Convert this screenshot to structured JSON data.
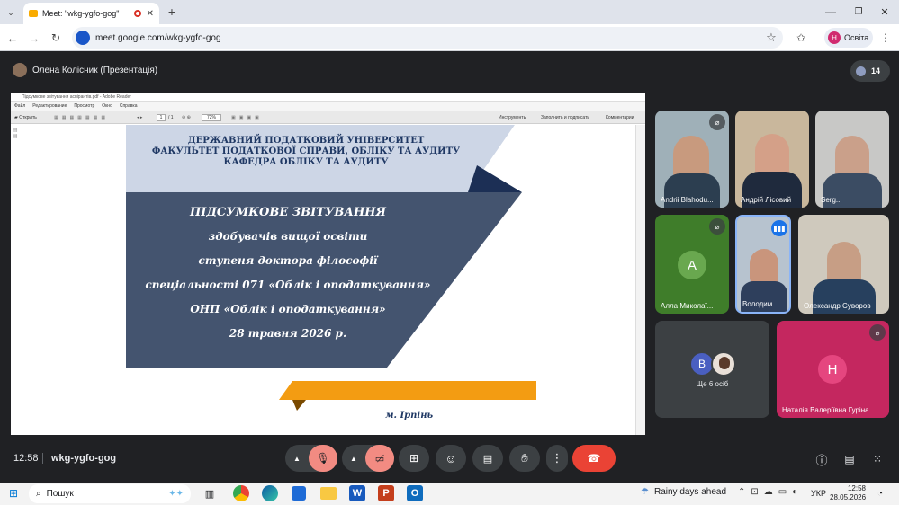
{
  "browser": {
    "tab_title": "Meet: \"wkg-ygfo-gog\"",
    "url": "meet.google.com/wkg-ygfo-gog",
    "profile_initial": "Н",
    "profile_label": "Освіта"
  },
  "meet": {
    "presenter": "Олена Колісник (Презентація)",
    "participant_count": "14",
    "time": "12:58",
    "meeting_code": "wkg-ygfo-gog"
  },
  "viewer": {
    "window_title": "Підсумкове звітування аспірантів.pdf - Adobe Reader",
    "menu": [
      "Файл",
      "Редактирование",
      "Просмотр",
      "Окно",
      "Справка"
    ],
    "open_label": "Открыть",
    "page": "1",
    "page_total": "/ 1",
    "zoom": "72%",
    "tools": [
      "Инструменты",
      "Заполнить и подписать",
      "Комментарии"
    ]
  },
  "slide": {
    "header_lines": [
      "ДЕРЖАВНИЙ ПОДАТКОВИЙ УНІВЕРСИТЕТ",
      "ФАКУЛЬТЕТ ПОДАТКОВОЇ СПРАВИ, ОБЛІКУ ТА АУДИТУ",
      "КАФЕДРА ОБЛІКУ ТА АУДИТУ"
    ],
    "body_lines": [
      "ПІДСУМКОВЕ ЗВІТУВАННЯ",
      "здобувачів вищої освіти",
      "ступеня доктора філософії",
      "спеціальності 071 «Облік і оподаткування»",
      "ОНП «Облік і оподаткування»",
      "28 травня 2026 р."
    ],
    "city": "м. Ірпінь"
  },
  "participants": [
    {
      "name": "Andrii Blahodu..."
    },
    {
      "name": "Андрій Лісовий"
    },
    {
      "name": "Serg..."
    },
    {
      "name": "Алла Миколаї...",
      "initial": "А",
      "color": "#3f7d2a"
    },
    {
      "name": "Володим..."
    },
    {
      "name": "Олександр Суворов"
    },
    {
      "name": "Ще 6 осіб",
      "initial": "B",
      "color": "#4a5fc1"
    },
    {
      "name": "Наталія Валеріївна Гуріна",
      "initial": "Н",
      "color": "#d12b6f"
    }
  ],
  "taskbar": {
    "search": "Пошук",
    "weather": "Rainy days ahead",
    "lang": "УКР",
    "clock_time": "12:58",
    "clock_date": "28.05.2026"
  }
}
